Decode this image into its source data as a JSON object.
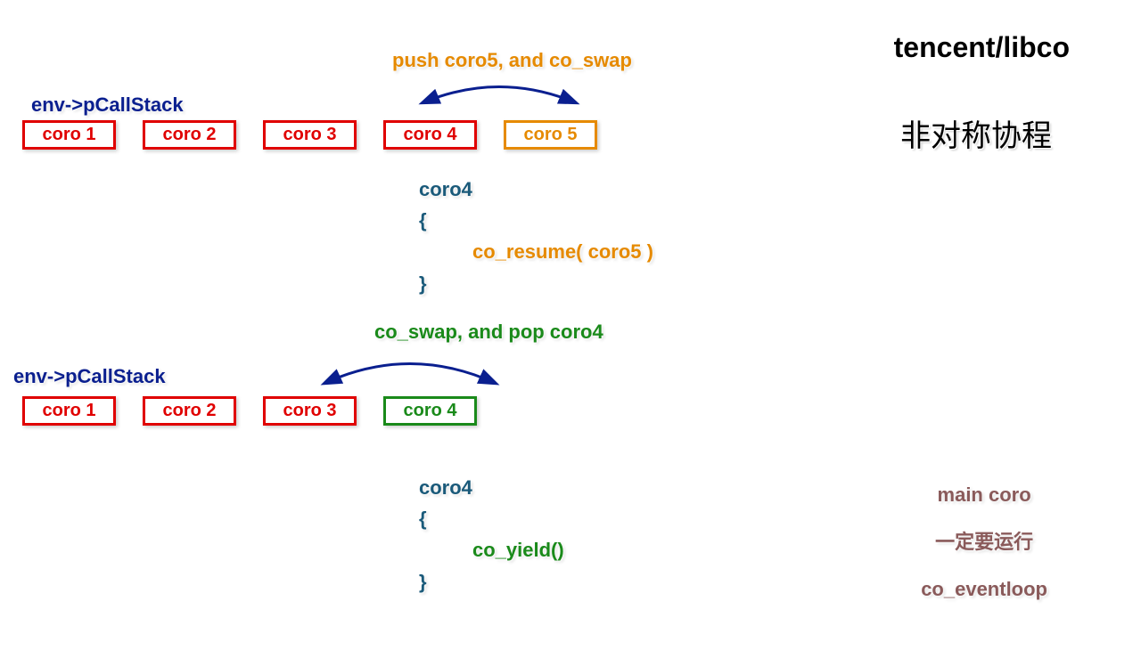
{
  "header": {
    "project": "tencent/libco",
    "subtitle": "非对称协程"
  },
  "top_section": {
    "action_label": "push coro5, and co_swap",
    "stack_label": "env->pCallStack",
    "boxes": [
      {
        "text": "coro 1",
        "style": "red"
      },
      {
        "text": "coro 2",
        "style": "red"
      },
      {
        "text": "coro 3",
        "style": "red"
      },
      {
        "text": "coro 4",
        "style": "red"
      },
      {
        "text": "coro 5",
        "style": "orange"
      }
    ],
    "code": {
      "fn": "coro4",
      "open": "{",
      "body": "co_resume( coro5 )",
      "close": "}"
    }
  },
  "bottom_section": {
    "action_label": "co_swap, and pop coro4",
    "stack_label": "env->pCallStack",
    "boxes": [
      {
        "text": "coro 1",
        "style": "red"
      },
      {
        "text": "coro 2",
        "style": "red"
      },
      {
        "text": "coro 3",
        "style": "red"
      },
      {
        "text": "coro 4",
        "style": "green"
      }
    ],
    "code": {
      "fn": "coro4",
      "open": "{",
      "body": "co_yield()",
      "close": "}"
    }
  },
  "footer": {
    "line1": "main coro",
    "line2": "一定要运行",
    "line3": "co_eventloop"
  }
}
